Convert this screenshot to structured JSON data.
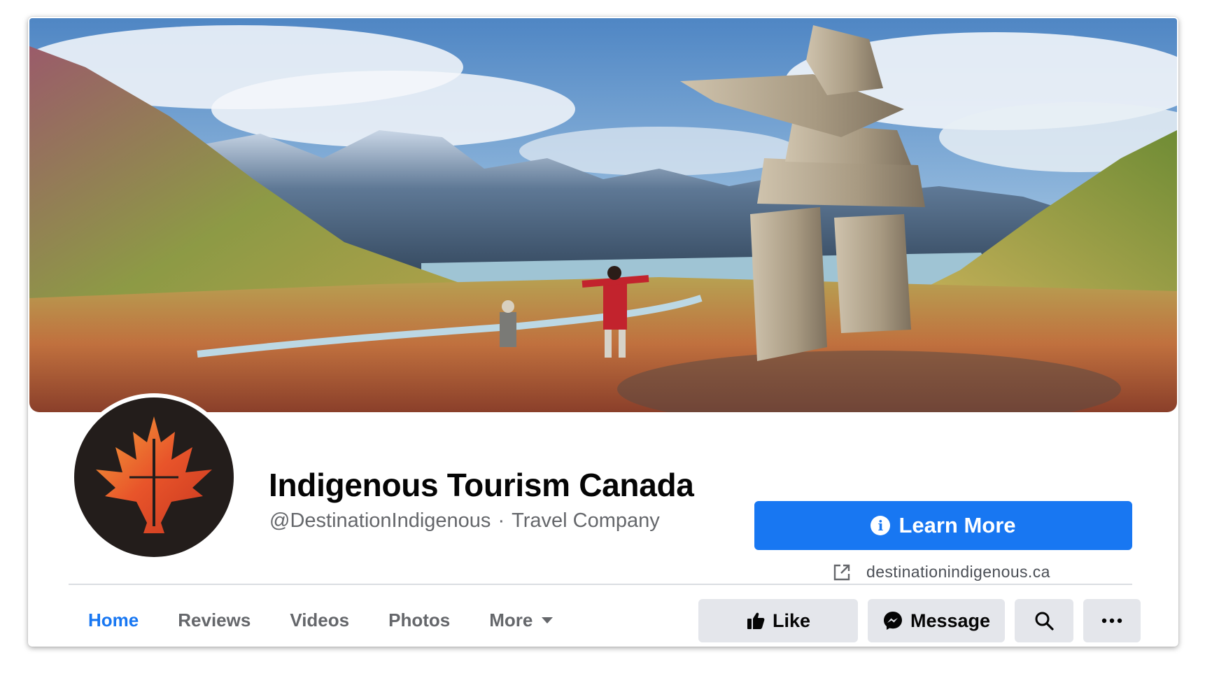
{
  "page": {
    "name": "Indigenous Tourism Canada",
    "handle": "@DestinationIndigenous",
    "separator": "·",
    "category": "Travel Company"
  },
  "cta": {
    "learn_more_label": "Learn More",
    "website": "destinationindigenous.ca"
  },
  "tabs": [
    {
      "label": "Home",
      "active": true
    },
    {
      "label": "Reviews",
      "active": false
    },
    {
      "label": "Videos",
      "active": false
    },
    {
      "label": "Photos",
      "active": false
    },
    {
      "label": "More",
      "active": false
    }
  ],
  "actions": {
    "like_label": "Like",
    "message_label": "Message"
  },
  "icons": {
    "cta": "info-icon",
    "website": "external-link-icon",
    "more": "caret-down-icon",
    "like": "thumbs-up-icon",
    "message": "messenger-icon",
    "search": "search-icon",
    "options": "ellipsis-icon"
  },
  "colors": {
    "brand_blue": "#1877f2",
    "secondary_button": "#e4e6eb",
    "muted_text": "#65676b",
    "avatar_background": "#231d1b",
    "logo_orange": "#e8542a"
  }
}
